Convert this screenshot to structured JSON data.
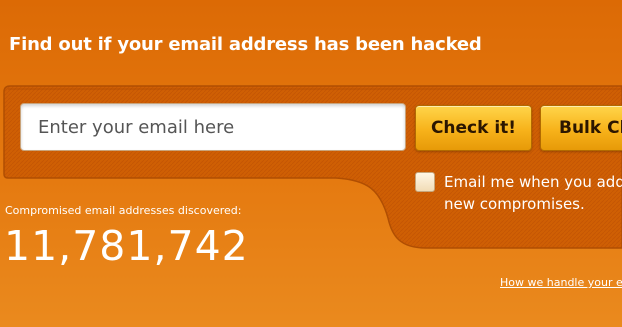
{
  "headline": "Find out if your email address has been hacked",
  "search": {
    "placeholder": "Enter your email here",
    "check_button": "Check it!",
    "bulk_button": "Bulk Check"
  },
  "notify": {
    "label": "Email me when you add new compromises."
  },
  "stats": {
    "label": "Compromised email addresses discovered:",
    "count": "11,781,742"
  },
  "footer": {
    "policy_link": "How we handle your email"
  },
  "colors": {
    "background": "#dc6a05",
    "panel": "#cf5f03",
    "button": "#f7b21a",
    "text": "#ffffff"
  }
}
